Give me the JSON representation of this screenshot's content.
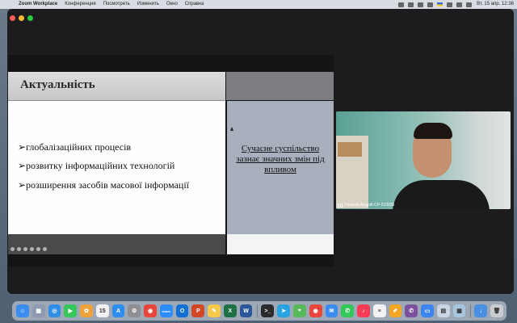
{
  "menubar": {
    "app_name": "Zoom Workplace",
    "items": [
      "Конференция",
      "Посмотреть",
      "Изменить",
      "Окно",
      "Справка"
    ],
    "clock": "Вт, 15 апр. 12:36"
  },
  "slide": {
    "title": "Актуальність",
    "bullets": [
      "➢глобалізаційних процесів",
      "➢розвитку інформаційних технологій",
      "➢розширення засобів масової інформації"
    ],
    "side_text": "Сучасне суспільство зазнає значних змін під впливом"
  },
  "video": {
    "participant": "Галанін Андрій СР-210036"
  },
  "dock": {
    "apps": [
      {
        "name": "finder-icon",
        "color": "#3b8ef0",
        "glyph": "☺"
      },
      {
        "name": "launchpad-icon",
        "color": "#8f9ab0",
        "glyph": "▦"
      },
      {
        "name": "safari-icon",
        "color": "#2f8fe8",
        "glyph": "◎"
      },
      {
        "name": "facetime-icon",
        "color": "#35c759",
        "glyph": "▶"
      },
      {
        "name": "photos-icon",
        "color": "#f0a33b",
        "glyph": "✿"
      },
      {
        "name": "calendar-icon",
        "color": "#f2f2f2",
        "glyph": "15"
      },
      {
        "name": "appstore-icon",
        "color": "#2d8cf0",
        "glyph": "A"
      },
      {
        "name": "settings-icon",
        "color": "#8e8e93",
        "glyph": "⚙"
      },
      {
        "name": "chrome-icon",
        "color": "#e8453c",
        "glyph": "◉"
      },
      {
        "name": "zoom-icon",
        "color": "#2d8cff",
        "glyph": "zoom"
      },
      {
        "name": "outlook-icon",
        "color": "#1170d4",
        "glyph": "O"
      },
      {
        "name": "powerpoint-icon",
        "color": "#d24726",
        "glyph": "P"
      },
      {
        "name": "notes-icon",
        "color": "#f7c948",
        "glyph": "✎"
      },
      {
        "name": "excel-icon",
        "color": "#1e7145",
        "glyph": "X"
      },
      {
        "name": "word-icon",
        "color": "#2b579a",
        "glyph": "W"
      },
      {
        "name": "terminal-icon",
        "color": "#2b2b2b",
        "glyph": ">_"
      },
      {
        "name": "telegram-icon",
        "color": "#2aa3e2",
        "glyph": "➤"
      },
      {
        "name": "maps-icon",
        "color": "#57b95a",
        "glyph": "⌖"
      },
      {
        "name": "chrome2-icon",
        "color": "#e8453c",
        "glyph": "◉"
      },
      {
        "name": "mail-icon",
        "color": "#3a8cf0",
        "glyph": "✉"
      },
      {
        "name": "messages-icon",
        "color": "#34c759",
        "glyph": "✆"
      },
      {
        "name": "music-icon",
        "color": "#fa3b55",
        "glyph": "♪"
      },
      {
        "name": "reminders-icon",
        "color": "#f2f2f2",
        "glyph": "≡"
      },
      {
        "name": "pages-icon",
        "color": "#f5a623",
        "glyph": "✐"
      },
      {
        "name": "viber-icon",
        "color": "#7b519d",
        "glyph": "✆"
      },
      {
        "name": "keynote-icon",
        "color": "#3d86f1",
        "glyph": "▭"
      },
      {
        "name": "preview-icon",
        "color": "#c9d5e3",
        "glyph": "▤"
      },
      {
        "name": "files-icon",
        "color": "#a9c4de",
        "glyph": "▦"
      },
      {
        "name": "downloads-icon",
        "color": "#4a90e2",
        "glyph": "↓"
      },
      {
        "name": "trash-icon",
        "color": "#c9ccd1",
        "glyph": "🗑"
      }
    ]
  }
}
